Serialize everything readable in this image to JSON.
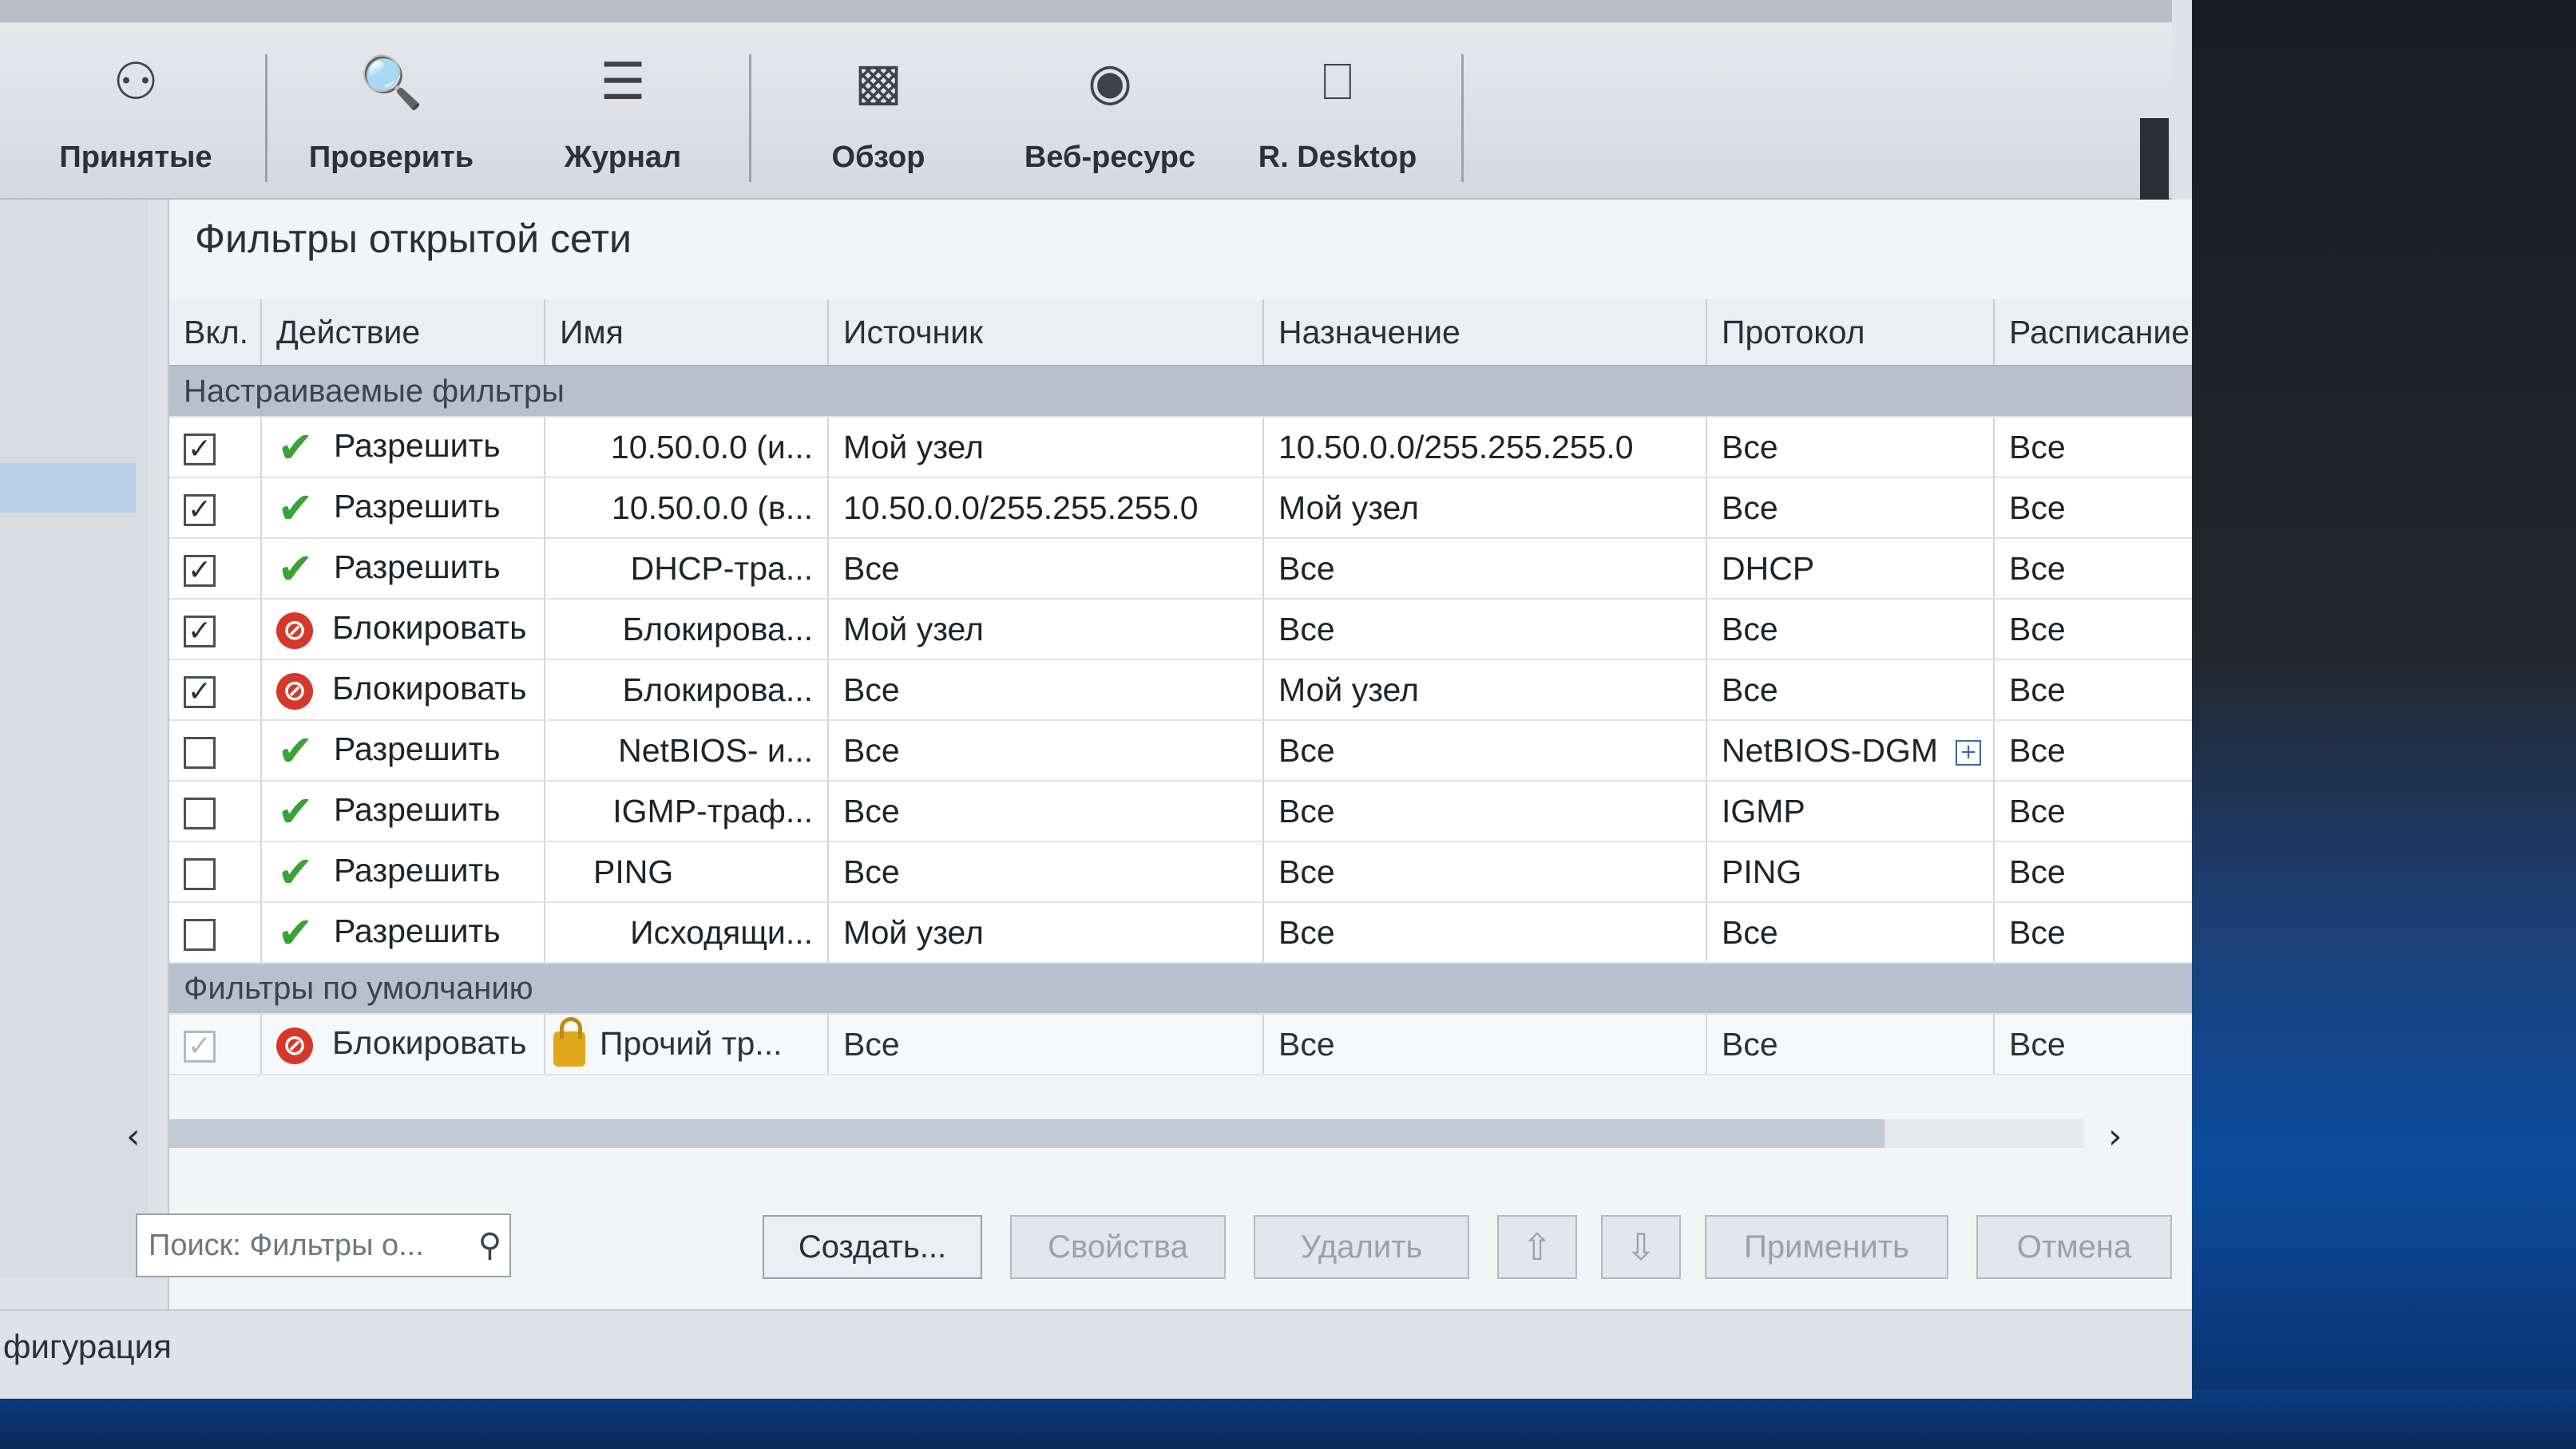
{
  "toolbar": {
    "items": [
      {
        "label": "Принятые",
        "icon": "received-icon"
      },
      {
        "label": "Проверить",
        "icon": "check-icon"
      },
      {
        "label": "Журнал",
        "icon": "journal-icon"
      },
      {
        "label": "Обзор",
        "icon": "overview-icon"
      },
      {
        "label": "Веб-ресурс",
        "icon": "web-resource-icon"
      },
      {
        "label": "R. Desktop",
        "icon": "remote-desktop-icon"
      }
    ]
  },
  "panel": {
    "title": "Фильтры открытой сети"
  },
  "table": {
    "columns": [
      "Вкл.",
      "Действие",
      "Имя",
      "Источник",
      "Назначение",
      "Протокол",
      "Расписание"
    ],
    "groups": {
      "custom": "Настраиваемые фильтры",
      "default": "Фильтры по умолчанию"
    },
    "rows": [
      {
        "enabled": "✓",
        "action": "Разрешить",
        "action_type": "allow",
        "name": "10.50.0.0 (и...",
        "source": "Мой узел",
        "destination": "10.50.0.0/255.255.255.0",
        "protocol": "Все",
        "schedule": "Все"
      },
      {
        "enabled": "✓",
        "action": "Разрешить",
        "action_type": "allow",
        "name": "10.50.0.0 (в...",
        "source": "10.50.0.0/255.255.255.0",
        "destination": "Мой узел",
        "protocol": "Все",
        "schedule": "Все"
      },
      {
        "enabled": "✓",
        "action": "Разрешить",
        "action_type": "allow",
        "name": "DHCP-тра...",
        "source": "Все",
        "destination": "Все",
        "protocol": "DHCP",
        "schedule": "Все"
      },
      {
        "enabled": "✓",
        "action": "Блокировать",
        "action_type": "block",
        "name": "Блокирова...",
        "source": "Мой узел",
        "destination": "Все",
        "protocol": "Все",
        "schedule": "Все"
      },
      {
        "enabled": "✓",
        "action": "Блокировать",
        "action_type": "block",
        "name": "Блокирова...",
        "source": "Все",
        "destination": "Мой узел",
        "protocol": "Все",
        "schedule": "Все"
      },
      {
        "enabled": "",
        "action": "Разрешить",
        "action_type": "allow",
        "name": "NetBIOS- и...",
        "source": "Все",
        "destination": "Все",
        "protocol": "NetBIOS-DGM",
        "schedule": "Все"
      },
      {
        "enabled": "",
        "action": "Разрешить",
        "action_type": "allow",
        "name": "IGMP-траф...",
        "source": "Все",
        "destination": "Все",
        "protocol": "IGMP",
        "schedule": "Все"
      },
      {
        "enabled": "",
        "action": "Разрешить",
        "action_type": "allow",
        "name": "PING",
        "source": "Все",
        "destination": "Все",
        "protocol": "PING",
        "schedule": "Все"
      },
      {
        "enabled": "",
        "action": "Разрешить",
        "action_type": "allow",
        "name": "Исходящи...",
        "source": "Мой узел",
        "destination": "Все",
        "protocol": "Все",
        "schedule": "Все"
      }
    ],
    "default_row": {
      "enabled": "✓",
      "action": "Блокировать",
      "name": "Прочий тр...",
      "source": "Все",
      "destination": "Все",
      "protocol": "Все",
      "schedule": "Все"
    }
  },
  "scroll": {
    "left": "‹",
    "right": "›"
  },
  "search": {
    "placeholder": "Поиск: Фильтры о..."
  },
  "buttons": {
    "create": "Создать...",
    "properties": "Свойства",
    "delete": "Удалить",
    "up": "⇧",
    "down": "⇩",
    "apply": "Применить",
    "cancel": "Отмена"
  },
  "status": {
    "text": "фигурация"
  },
  "colors": {
    "allow": "#3aa336",
    "block": "#d6372b",
    "group_header": "#b7c1ce"
  }
}
